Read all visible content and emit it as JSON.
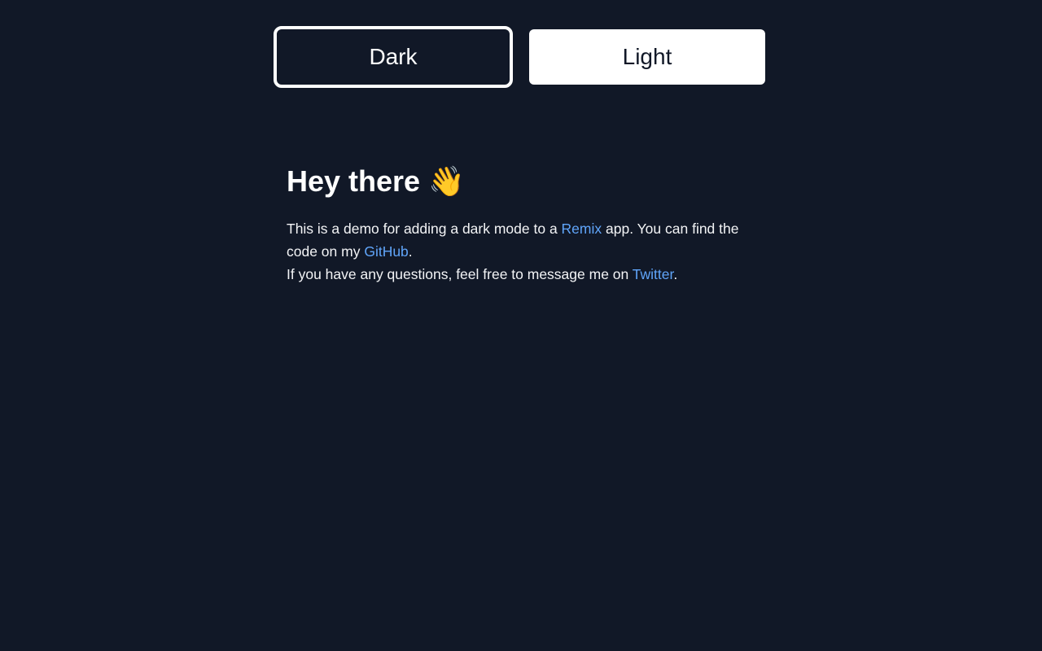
{
  "theme_toggle": {
    "dark_label": "Dark",
    "light_label": "Light",
    "selected": "Dark"
  },
  "main": {
    "heading": "Hey there",
    "heading_emoji": "👋",
    "paragraph1": {
      "text_before_remix": "This is a demo for adding a dark mode to a ",
      "remix_link": "Remix",
      "text_after_remix": " app. You can find the code on my ",
      "github_link": "GitHub",
      "end": "."
    },
    "paragraph2": {
      "text_before_twitter": "If you have any questions, feel free to message me on ",
      "twitter_link": "Twitter",
      "end": "."
    }
  },
  "colors": {
    "background": "#111827",
    "text": "#f3f4f6",
    "link": "#60a5fa",
    "light_button_bg": "#ffffff"
  }
}
